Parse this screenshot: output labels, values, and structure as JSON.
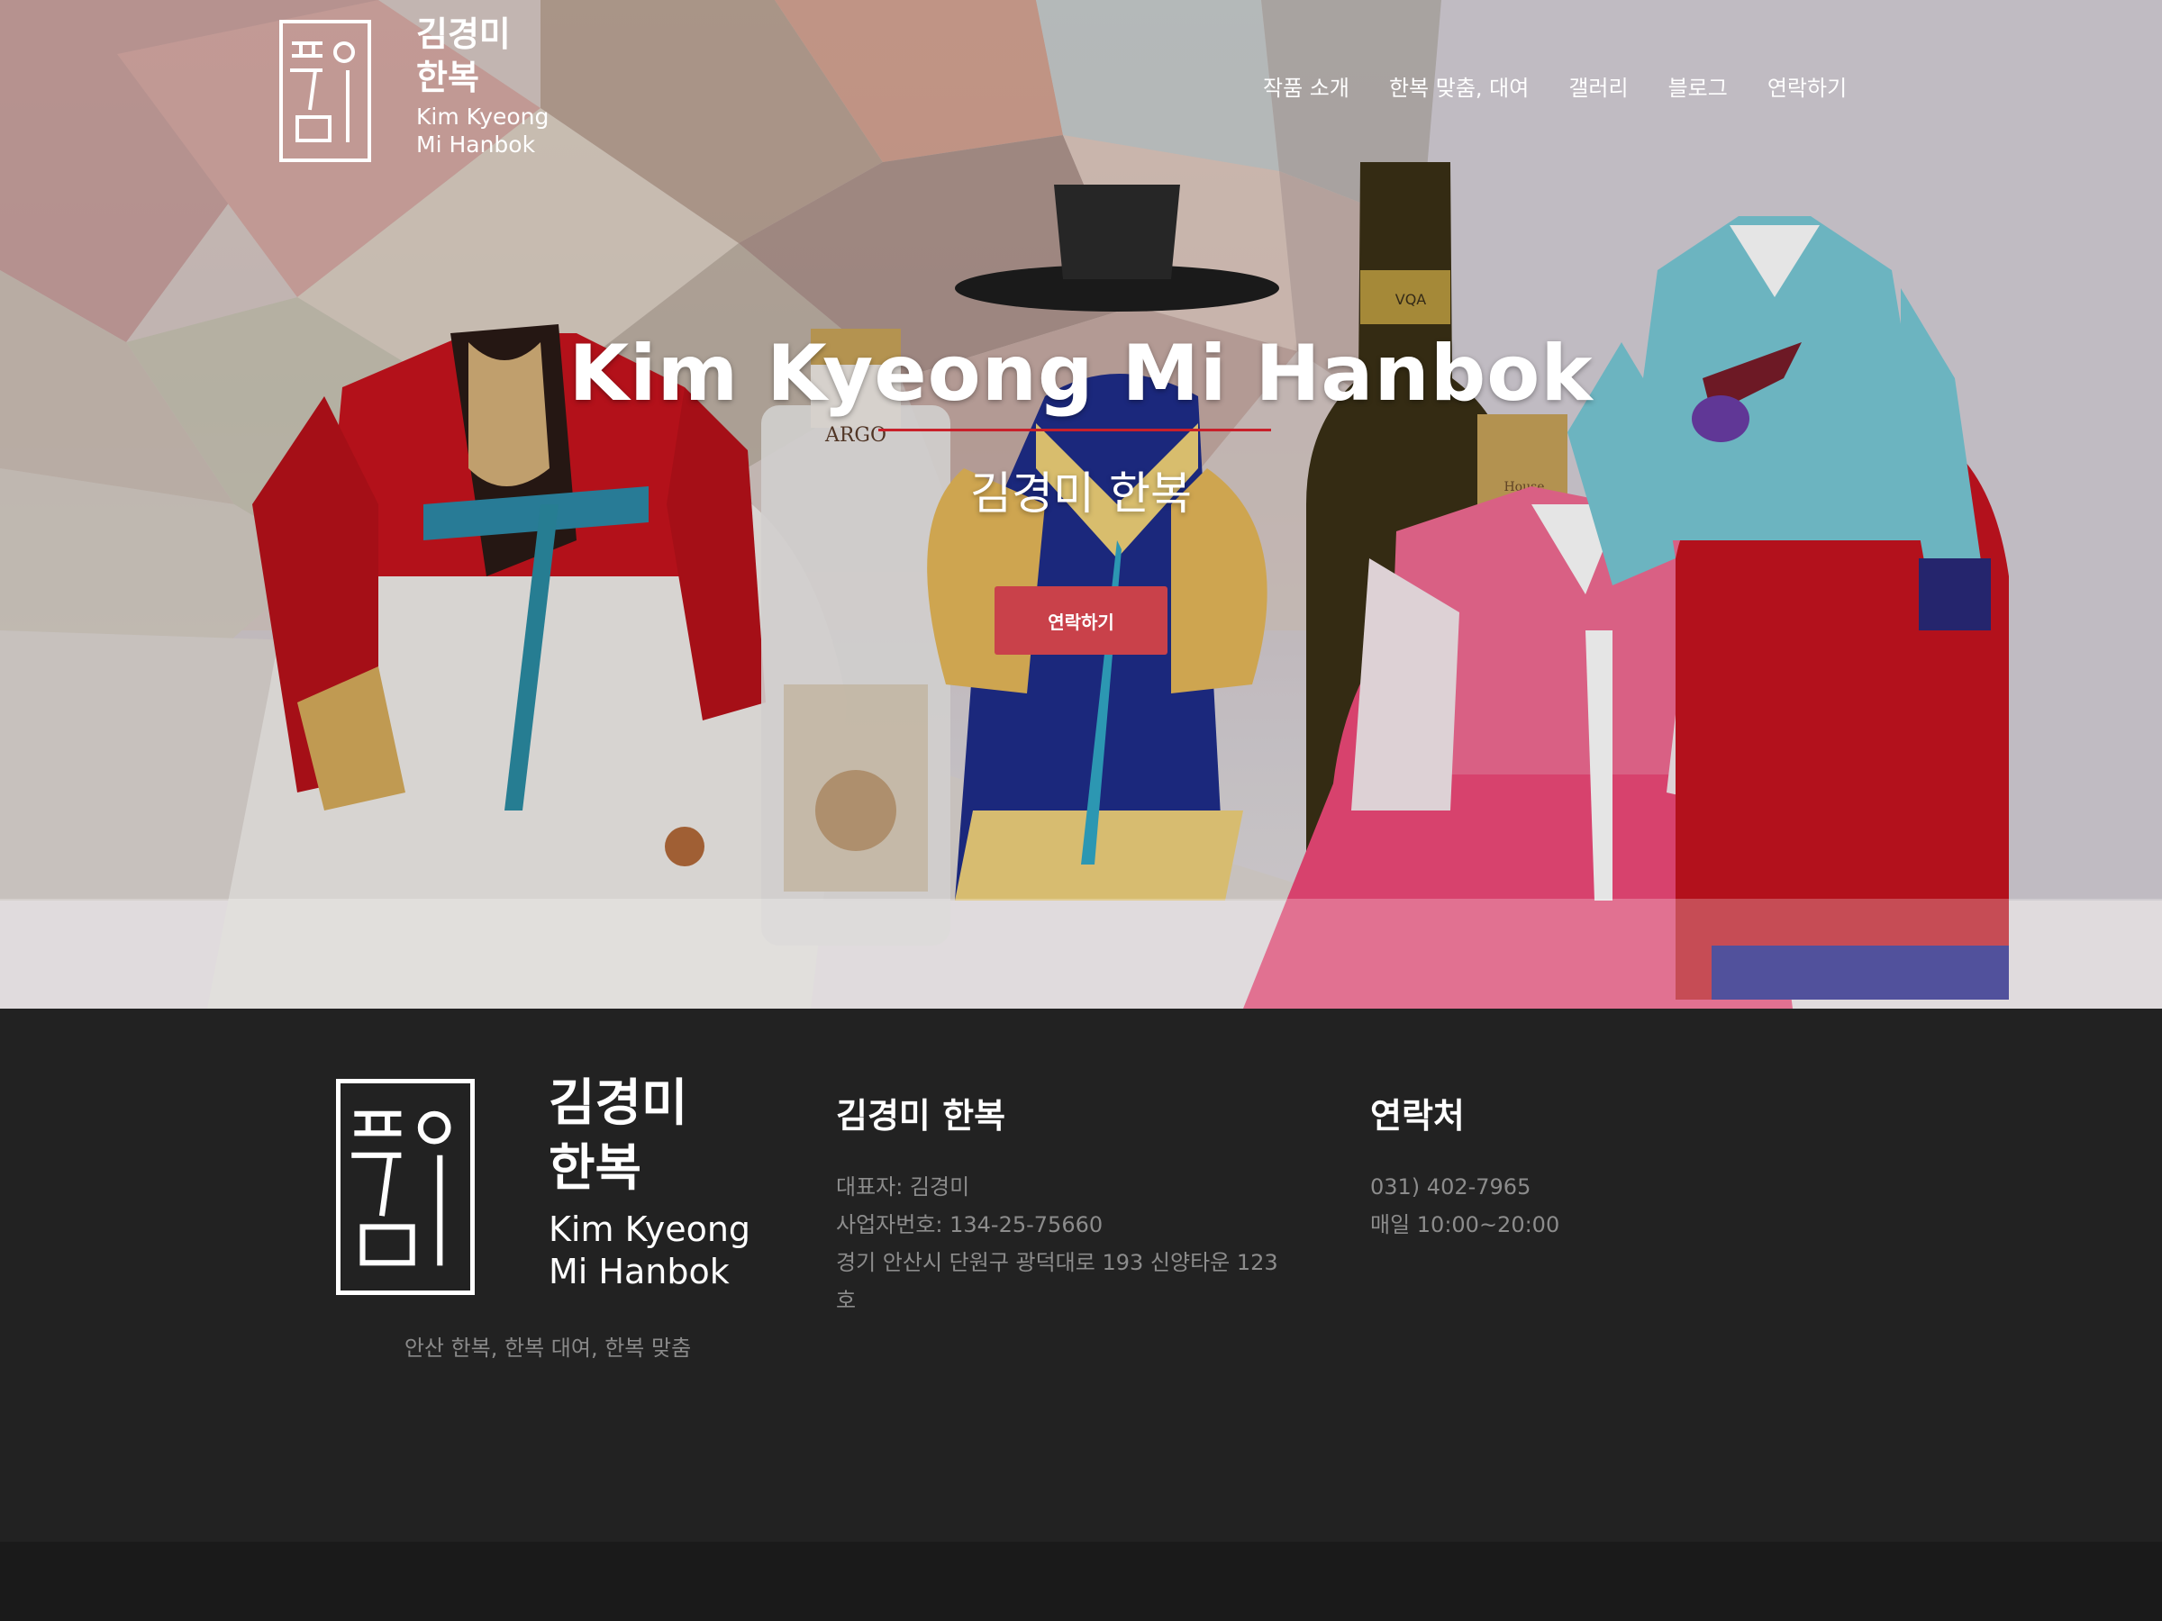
{
  "header": {
    "logo_name_ko_line1": "김경미",
    "logo_name_ko_line2": "한복",
    "logo_name_en_line1": "Kim Kyeong",
    "logo_name_en_line2": "Mi Hanbok",
    "nav": [
      "작품 소개",
      "한복 맞춤, 대여",
      "갤러리",
      "블로그",
      "연락하기"
    ]
  },
  "hero": {
    "title": "Kim Kyeong Mi Hanbok",
    "subtitle": "김경미 한복",
    "cta_label": "연락하기",
    "cta_color": "#c9414a",
    "rule_color": "#c8202a",
    "bottle_labels": [
      "ARGO",
      "VQA",
      "House"
    ]
  },
  "footer": {
    "logo_name_ko_line1": "김경미",
    "logo_name_ko_line2": "한복",
    "logo_name_en_line1": "Kim Kyeong",
    "logo_name_en_line2": "Mi Hanbok",
    "tagline": "안산 한복, 한복 대여, 한복 맞춤",
    "business": {
      "heading": "김경미 한복",
      "lines": [
        "대표자: 김경미",
        "사업자번호: 134-25-75660",
        "경기 안산시 단원구 광덕대로 193 신양타운 123",
        "호"
      ]
    },
    "contact": {
      "heading": "연락처",
      "lines": [
        "031) 402-7965",
        "매일 10:00~20:00"
      ]
    }
  }
}
